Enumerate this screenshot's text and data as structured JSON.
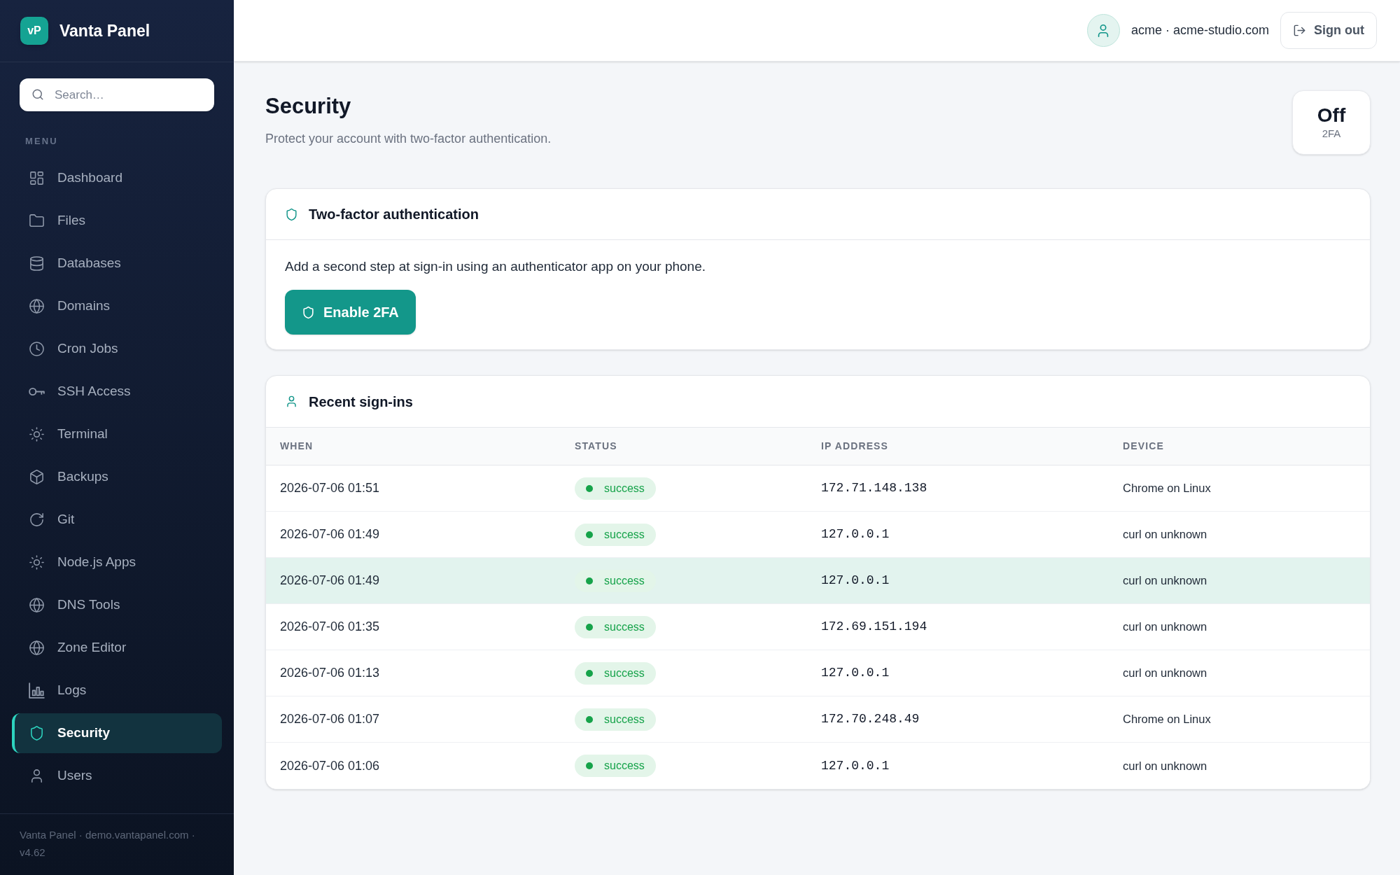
{
  "sidebar": {
    "brand": {
      "logo": "vP",
      "name": "Vanta Panel"
    },
    "search": {
      "placeholder": "Search…"
    },
    "section_label": "MENU",
    "items": [
      {
        "label": "Dashboard",
        "selected": false
      },
      {
        "label": "Files",
        "selected": false
      },
      {
        "label": "Databases",
        "selected": false
      },
      {
        "label": "Domains",
        "selected": false
      },
      {
        "label": "Cron Jobs",
        "selected": false
      },
      {
        "label": "SSH Access",
        "selected": false
      },
      {
        "label": "Terminal",
        "selected": false
      },
      {
        "label": "Backups",
        "selected": false
      },
      {
        "label": "Git",
        "selected": false
      },
      {
        "label": "Node.js Apps",
        "selected": false
      },
      {
        "label": "DNS Tools",
        "selected": false
      },
      {
        "label": "Zone Editor",
        "selected": false
      },
      {
        "label": "Logs",
        "selected": false
      },
      {
        "label": "Security",
        "selected": true
      },
      {
        "label": "Users",
        "selected": false
      }
    ],
    "footer": "Vanta Panel · demo.vantapanel.com · v4.62"
  },
  "header": {
    "account": "acme · acme-studio.com",
    "sign_out": "Sign out"
  },
  "page": {
    "title": "Security",
    "subtitle": "Protect your account with two-factor authentication.",
    "stat": {
      "value": "Off",
      "label": "2FA"
    }
  },
  "two_factor": {
    "title": "Two-factor authentication",
    "description": "Add a second step at sign-in using an authenticator app on your phone.",
    "button": "Enable 2FA"
  },
  "recent_signins": {
    "title": "Recent sign-ins",
    "columns": [
      "WHEN",
      "STATUS",
      "IP ADDRESS",
      "DEVICE"
    ],
    "rows": [
      {
        "when": "2026-07-06 01:51",
        "status": "success",
        "ip": "172.71.148.138",
        "device": "Chrome on Linux",
        "highlighted": false
      },
      {
        "when": "2026-07-06 01:49",
        "status": "success",
        "ip": "127.0.0.1",
        "device": "curl on unknown",
        "highlighted": false
      },
      {
        "when": "2026-07-06 01:49",
        "status": "success",
        "ip": "127.0.0.1",
        "device": "curl on unknown",
        "highlighted": true
      },
      {
        "when": "2026-07-06 01:35",
        "status": "success",
        "ip": "172.69.151.194",
        "device": "curl on unknown",
        "highlighted": false
      },
      {
        "when": "2026-07-06 01:13",
        "status": "success",
        "ip": "127.0.0.1",
        "device": "curl on unknown",
        "highlighted": false
      },
      {
        "when": "2026-07-06 01:07",
        "status": "success",
        "ip": "172.70.248.49",
        "device": "Chrome on Linux",
        "highlighted": false
      },
      {
        "when": "2026-07-06 01:06",
        "status": "success",
        "ip": "127.0.0.1",
        "device": "curl on unknown",
        "highlighted": false
      }
    ]
  }
}
